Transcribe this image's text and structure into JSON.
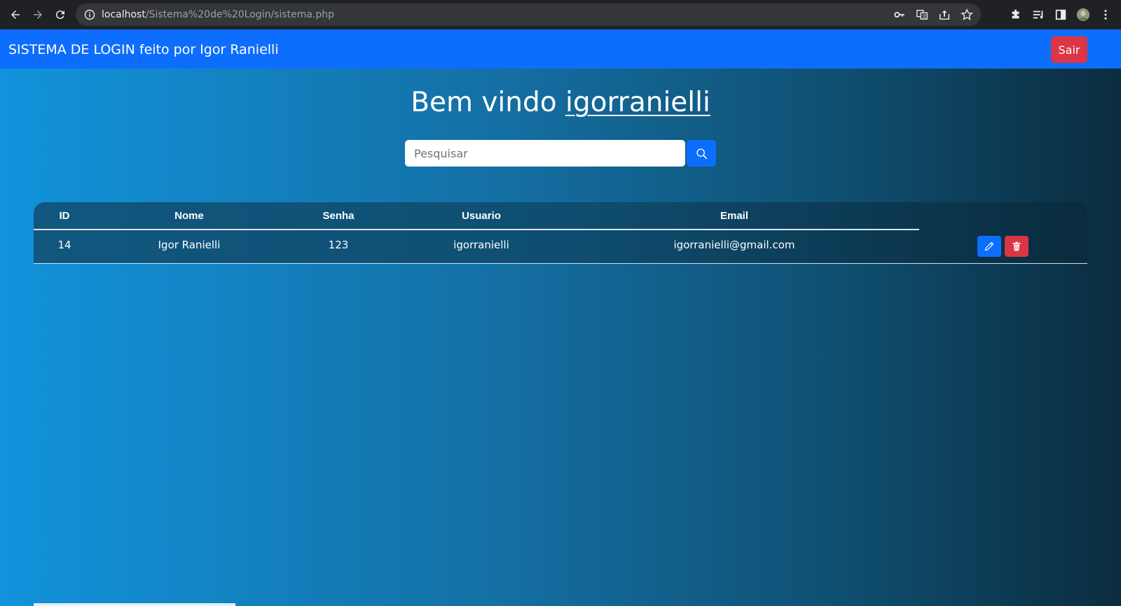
{
  "browser": {
    "url_host": "localhost",
    "url_path": "/Sistema%20de%20Login/sistema.php"
  },
  "navbar": {
    "brand": "SISTEMA DE LOGIN feito por Igor Ranielli",
    "logout_label": "Sair"
  },
  "welcome": {
    "prefix": "Bem vindo ",
    "username": "igorranielli"
  },
  "search": {
    "placeholder": "Pesquisar"
  },
  "table": {
    "headers": {
      "id": "ID",
      "nome": "Nome",
      "senha": "Senha",
      "usuario": "Usuario",
      "email": "Email"
    },
    "rows": [
      {
        "id": "14",
        "nome": "Igor Ranielli",
        "senha": "123",
        "usuario": "igorranielli",
        "email": "igorranielli@gmail.com"
      }
    ]
  },
  "colors": {
    "primary": "#0d6efd",
    "danger": "#dc3545",
    "chrome_bg": "#202124"
  }
}
